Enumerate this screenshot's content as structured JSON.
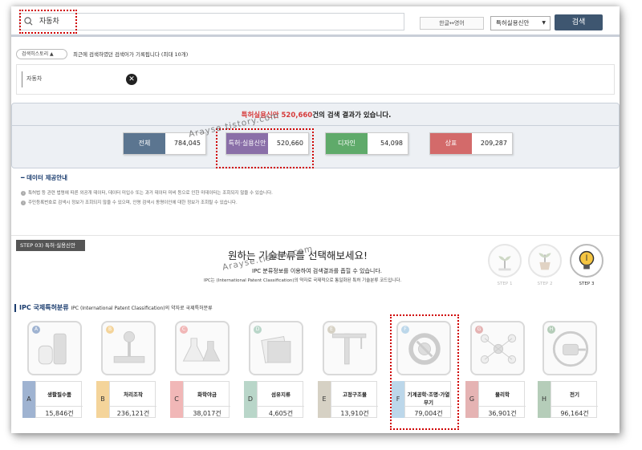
{
  "search": {
    "value": "자동차"
  },
  "header": {
    "lang_toggle": "한글↔영어",
    "type_select": "특허실용신안",
    "search_button": "검색"
  },
  "history": {
    "toggle_label": "검색히스토리",
    "description": "최근에 검색하였던 검색어가 기록됩니다 (최대 10개)",
    "items": [
      "자동차"
    ]
  },
  "results": {
    "prefix": "특허실용신안 520,660",
    "suffix": "건의 검색 결과가 있습니다.",
    "categories": [
      {
        "label": "전체",
        "count": "784,045",
        "color": "#5b7590"
      },
      {
        "label": "특허·실용신안",
        "count": "520,660",
        "color": "#8a6fa8"
      },
      {
        "label": "디자인",
        "count": "54,098",
        "color": "#5faa6a"
      },
      {
        "label": "상표",
        "count": "209,287",
        "color": "#d36a6a"
      }
    ]
  },
  "notice": {
    "title": "데이터 제공안내",
    "lines": [
      "특허법 등 관련 법령에 따른 외공개 데이터, 데이터 미입수 또는 과거 데이터 미비 등으로 인한 미데이터는 조회되지 않을 수 있습니다.",
      "주민등록번호로 검색시 정보가 조회되지 않을 수 있으며, 인명 검색시 동명이인에 대한 정보가 조회될 수 있습니다."
    ]
  },
  "step": {
    "badge": "STEP 03) 특허·실용신안",
    "heading": "원하는 기술분류를 선택해보세요!",
    "sub": "IPC 분류정보를 이용하여 검색결과를 좁힐 수 있습니다.",
    "sub2": "IPC는 (International Patent Classification)의 약자로 국제적으로 통일화된 특허 기술분류 코드입니다.",
    "steps": [
      "STEP 1",
      "STEP 2",
      "STEP 3"
    ]
  },
  "ipc": {
    "title": "IPC 국제특허분류",
    "subtitle": "IPC (International Patent Classification)의 약자로 국제특허분류",
    "items": [
      {
        "letter": "A",
        "name": "생활필수품",
        "count": "15,846건",
        "color": "#9fb3d1"
      },
      {
        "letter": "B",
        "name": "처리조작",
        "count": "236,121건",
        "color": "#f4d49a"
      },
      {
        "letter": "C",
        "name": "화학야금",
        "count": "38,017건",
        "color": "#f1b7b7"
      },
      {
        "letter": "D",
        "name": "섬유지류",
        "count": "4,605건",
        "color": "#b9d6c9"
      },
      {
        "letter": "E",
        "name": "고정구조물",
        "count": "13,910건",
        "color": "#d6d1c4"
      },
      {
        "letter": "F",
        "name": "기계공학·조명·가열무기",
        "count": "79,004건",
        "color": "#bcd7ea"
      },
      {
        "letter": "G",
        "name": "물리학",
        "count": "36,901건",
        "color": "#e5b3b3"
      },
      {
        "letter": "H",
        "name": "전기",
        "count": "96,164건",
        "color": "#b5cdb9"
      }
    ]
  },
  "watermark": "Arayse.tistory.com"
}
